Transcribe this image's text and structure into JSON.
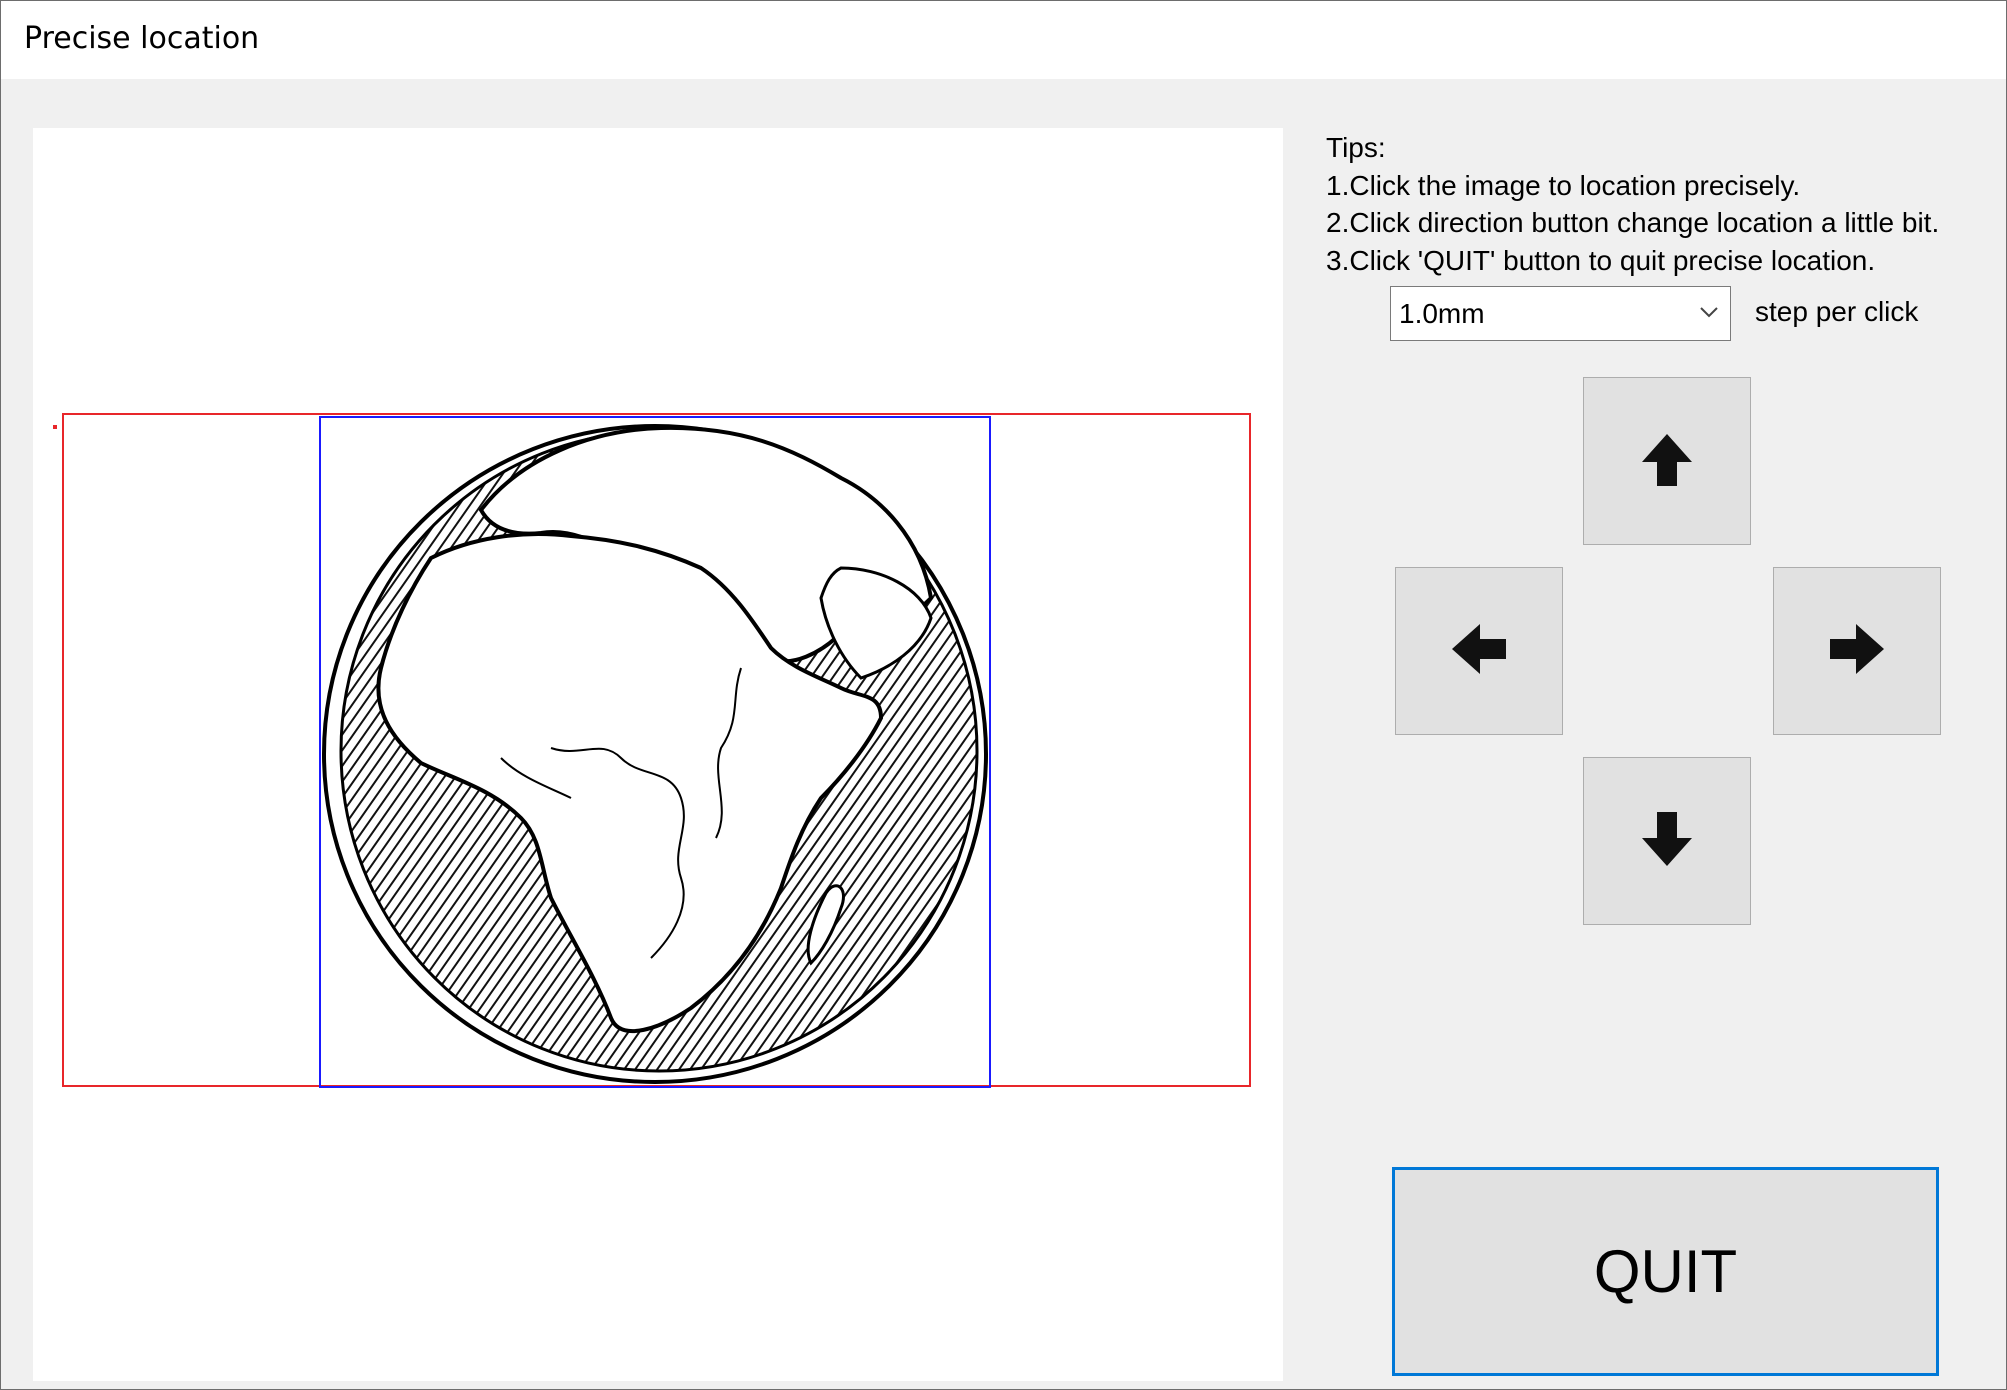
{
  "window": {
    "title": "Precise location"
  },
  "tips": {
    "heading": "Tips:",
    "lines": [
      "1.Click the image to location precisely.",
      "2.Click direction button change location a little bit.",
      "3.Click 'QUIT' button to quit precise location."
    ]
  },
  "step": {
    "selected": "1.0mm",
    "label": "step per click"
  },
  "buttons": {
    "quit_label": "QUIT"
  },
  "icons": {
    "up": "arrow-up-icon",
    "down": "arrow-down-icon",
    "left": "arrow-left-icon",
    "right": "arrow-right-icon",
    "dropdown": "chevron-down-icon"
  },
  "colors": {
    "work_area_border": "#e8262a",
    "image_border": "#1a1aff",
    "quit_focus_border": "#0078d7",
    "button_face": "#e1e1e1",
    "window_background": "#f0f0f0"
  }
}
